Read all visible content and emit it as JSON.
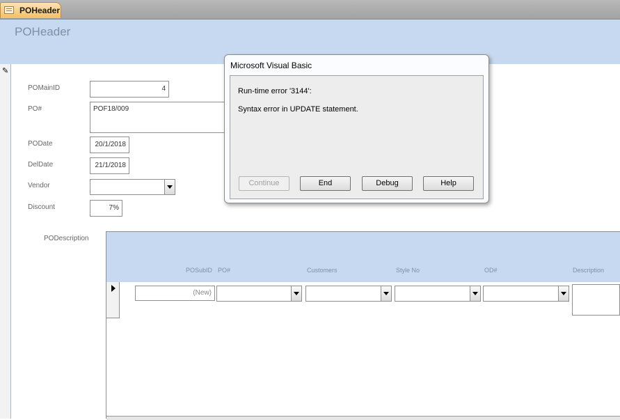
{
  "tab": {
    "label": "POHeader",
    "icon": "form-icon"
  },
  "form": {
    "title": "POHeader",
    "fields": {
      "po_main_id": {
        "label": "POMainID",
        "value": "4"
      },
      "po_number": {
        "label": "PO#",
        "value": "POF18/009"
      },
      "po_date": {
        "label": "PODate",
        "value": "20/1/2018"
      },
      "del_date": {
        "label": "DelDate",
        "value": "21/1/2018"
      },
      "vendor": {
        "label": "Vendor",
        "value": ""
      },
      "discount": {
        "label": "Discount",
        "value": "7%"
      }
    },
    "record_selector_icon": "pencil-icon"
  },
  "subform": {
    "label": "PODescription",
    "columns": [
      "POSubID",
      "PO#",
      "Customers",
      "Style No",
      "OD#",
      "Description"
    ],
    "new_row": {
      "posubid": "(New)"
    }
  },
  "dialog": {
    "title": "Microsoft Visual Basic",
    "error_line1": "Run-time error '3144':",
    "error_line2": "Syntax error in UPDATE statement.",
    "buttons": {
      "continue": "Continue",
      "end": "End",
      "debug": "Debug",
      "help": "Help"
    }
  },
  "colors": {
    "header_bg": "#c6d9f0",
    "tab_active": "#f3c167"
  }
}
